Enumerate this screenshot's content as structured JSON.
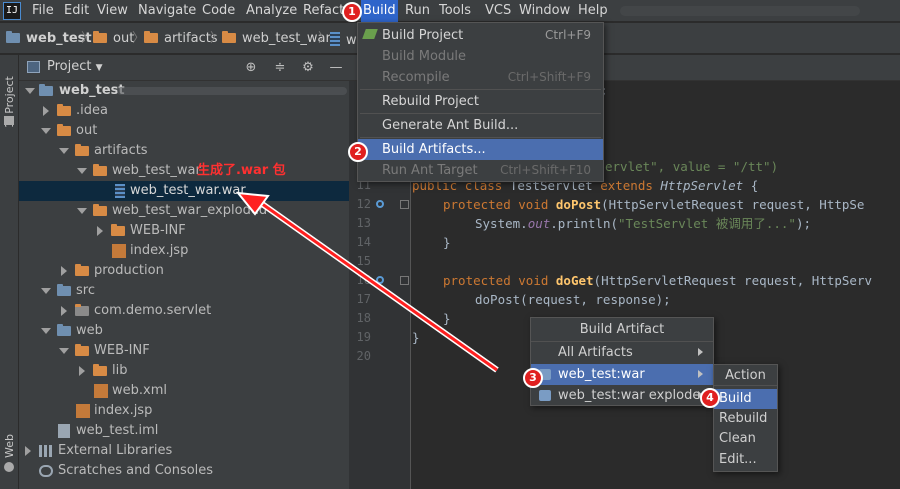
{
  "menu": {
    "items": [
      "File",
      "Edit",
      "View",
      "Navigate",
      "Code",
      "Analyze",
      "Refactor",
      "Build",
      "Run",
      "Tools",
      "VCS",
      "Window",
      "Help"
    ]
  },
  "breadcrumb": [
    "web_test",
    "out",
    "artifacts",
    "web_test_war",
    "w"
  ],
  "toolstrip": {
    "project_label": "1: Project",
    "web_label": "Web"
  },
  "project_panel": {
    "title": "Project"
  },
  "tree": [
    {
      "label": "web_test"
    },
    {
      "label": ".idea"
    },
    {
      "label": "out"
    },
    {
      "label": "artifacts"
    },
    {
      "label": "web_test_war"
    },
    {
      "label": "web_test_war.war"
    },
    {
      "label": "web_test_war_exploded"
    },
    {
      "label": "WEB-INF"
    },
    {
      "label": "index.jsp"
    },
    {
      "label": "production"
    },
    {
      "label": "src"
    },
    {
      "label": "com.demo.servlet"
    },
    {
      "label": "web"
    },
    {
      "label": "WEB-INF"
    },
    {
      "label": "lib"
    },
    {
      "label": "web.xml"
    },
    {
      "label": "index.jsp"
    },
    {
      "label": "web_test.iml"
    },
    {
      "label": "External Libraries"
    },
    {
      "label": "Scratches and Consoles"
    }
  ],
  "annotation_text": "生成了.war 包",
  "build_menu": [
    {
      "label": "Build Project",
      "shortcut": "Ctrl+F9"
    },
    {
      "label": "Build Module",
      "shortcut": ""
    },
    {
      "label": "Recompile",
      "shortcut": "Ctrl+Shift+F9"
    },
    {
      "label": "Rebuild Project",
      "shortcut": ""
    },
    {
      "label": "Generate Ant Build...",
      "shortcut": ""
    },
    {
      "label": "Build Artifacts...",
      "shortcut": ""
    },
    {
      "label": "Run Ant Target",
      "shortcut": "Ctrl+Shift+F10"
    }
  ],
  "editor": {
    "line_numbers": [
      "11",
      "12",
      "13",
      "14",
      "15",
      "16",
      "17",
      "18",
      "19",
      "20"
    ],
    "partial_top": [
      ";"
    ],
    "line10_tail": "ervlet\", value = \"/tt\")",
    "code": {
      "l11_kw1": "public",
      "l11_kw2": "class",
      "l11_name": "TestServlet",
      "l11_kw3": "extends",
      "l11_parent": "HttpServlet",
      "l11_end": " {",
      "l12_kw1": "protected",
      "l12_kw2": "void",
      "l12_fn": "doPost",
      "l12_rest": "(HttpServletRequest request, HttpSe",
      "l13_a": "System.",
      "l13_out": "out",
      "l13_b": ".println(",
      "l13_str": "\"TestServlet 被调用了...\"",
      "l13_c": ");",
      "l14": "}",
      "l16_kw1": "protected",
      "l16_kw2": "void",
      "l16_fn": "doGet",
      "l16_rest": "(HttpServletRequest request, HttpServ",
      "l17": "doPost(request, response);",
      "l18": "}",
      "l19": "}"
    }
  },
  "build_artifact_popup": {
    "title": "Build Artifact",
    "items": [
      "All Artifacts",
      "web_test:war",
      "web_test:war exploded"
    ]
  },
  "action_popup": {
    "title": "Action",
    "items": [
      "Build",
      "Rebuild",
      "Clean",
      "Edit..."
    ]
  },
  "badges": [
    "1",
    "2",
    "3",
    "4"
  ]
}
